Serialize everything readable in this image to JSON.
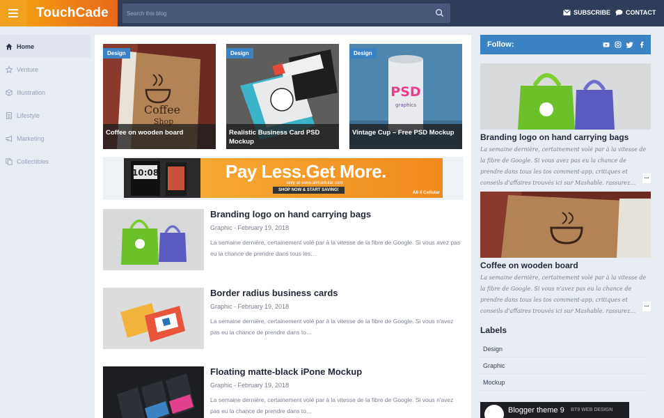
{
  "header": {
    "logo": "TouchCade",
    "search_placeholder": "Search this blog",
    "subscribe": "SUBSCRIBE",
    "contact": "CONTACT"
  },
  "leftnav": {
    "items": [
      {
        "label": "Home",
        "icon": "home-icon",
        "active": true
      },
      {
        "label": "Venture",
        "icon": "star-icon"
      },
      {
        "label": "Illustration",
        "icon": "cube-icon"
      },
      {
        "label": "Lifestyle",
        "icon": "file-icon"
      },
      {
        "label": "Marketing",
        "icon": "megaphone-icon"
      },
      {
        "label": "Collectibles",
        "icon": "copy-icon"
      }
    ]
  },
  "featured": [
    {
      "badge": "Design",
      "title": "Coffee on wooden board"
    },
    {
      "badge": "Design",
      "title": "Realistic Business Card PSD Mockup"
    },
    {
      "badge": "Design",
      "title": "Vintage Cup – Free PSD Mockup"
    }
  ],
  "banner": {
    "headline": "Pay Less.Get More.",
    "subline": "only at www.all4cellular.com",
    "cta": "SHOP NOW & START SAVING!",
    "brand": "All 4 Cellular"
  },
  "posts": [
    {
      "title": "Branding logo on hand carrying bags",
      "meta": "Graphic - February 19, 2018",
      "excerpt": "La semaine dernière, certainement volé par à la vitesse de la fibre de Google. Si vous avez pas eu la chance de prendre dans tous les…"
    },
    {
      "title": "Border radius business cards",
      "meta": "Graphic - February 19, 2018",
      "excerpt": "La semaine dernière, certainement volé par à la vitesse de la fibre de Google. Si vous n'avez pas eu la chance de prendre dans to…"
    },
    {
      "title": "Floating matte-black iPone Mockup",
      "meta": "Graphic - February 19, 2018",
      "excerpt": "La semaine dernière, certainement volé par à la vitesse de la fibre de Google. Si vous n'avez pas eu la chance de prendre dans to…"
    }
  ],
  "right": {
    "follow": "Follow:",
    "posts": [
      {
        "title": "Branding logo on hand carrying bags",
        "text": "La semaine dernière, certainement volé par à la vitesse de la fibre de Google. Si vous avez pas eu la chance de prendre dans tous les tos comment-app, critiques et conseils d'affaires trouvés ici sur Mashable, rassurez…",
        "more": "..."
      },
      {
        "title": "Coffee on wooden board",
        "text": "La semaine dernière, certainement volé par à la vitesse de la fibre de Google. Si vous n'avez pas eu la chance de prendre dans tous les tos comment-app, critiques et conseils d'affaires trouvés ici sur Mashable, rassurez…",
        "more": "..."
      }
    ],
    "labels_heading": "Labels",
    "labels": [
      "Design",
      "Graphic",
      "Mockup"
    ],
    "video_title": "Blogger theme 9",
    "video_brand": "BT9 WEB DESIGN"
  }
}
